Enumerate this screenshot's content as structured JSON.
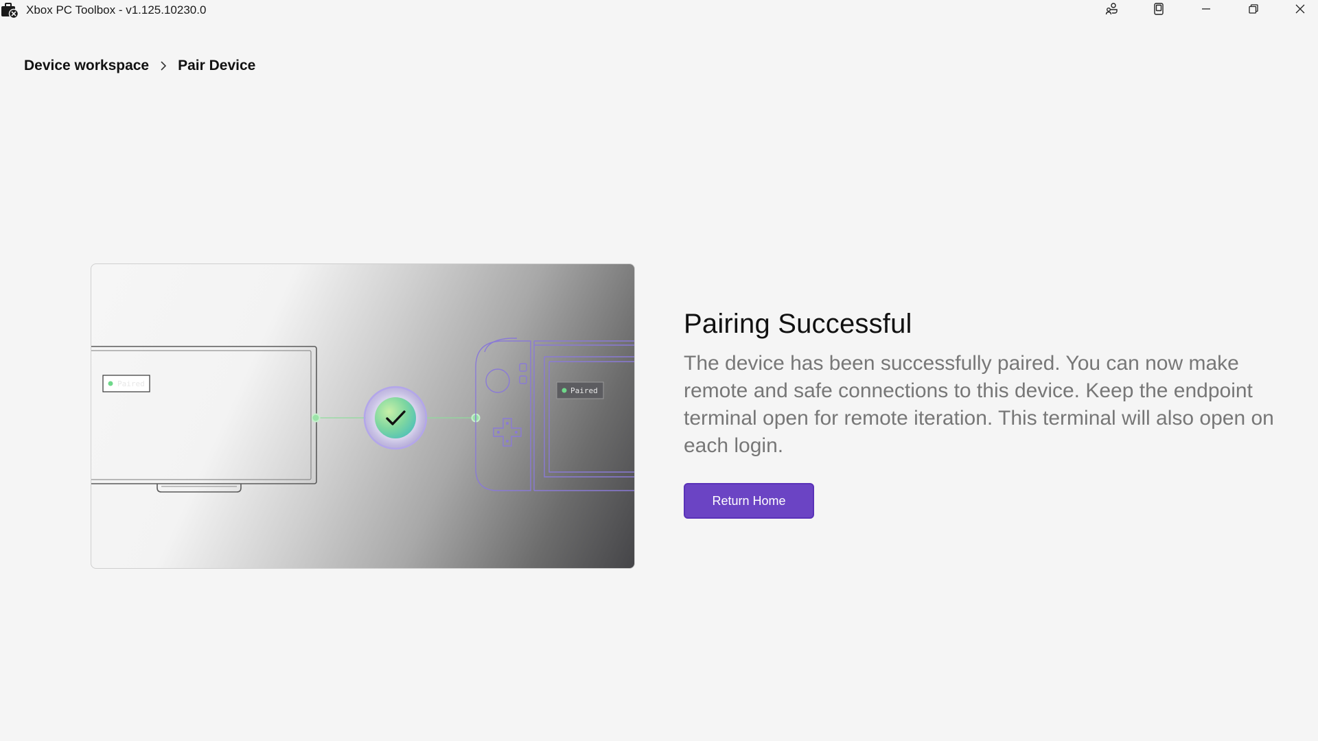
{
  "window": {
    "title": "Xbox PC Toolbox - v1.125.10230.0"
  },
  "breadcrumb": {
    "items": [
      "Device workspace",
      "Pair Device"
    ]
  },
  "illustration": {
    "left_badge": "Paired",
    "right_badge": "Paired"
  },
  "result": {
    "heading": "Pairing Successful",
    "description": "The device has been successfully paired. You can now make remote and safe connections to this device. Keep the endpoint terminal open for remote iteration. This terminal will also open on each login.",
    "button_label": "Return Home"
  },
  "colors": {
    "accent": "#6b44c4",
    "success": "#6fd88a",
    "device_outline": "#8a7ad6"
  }
}
